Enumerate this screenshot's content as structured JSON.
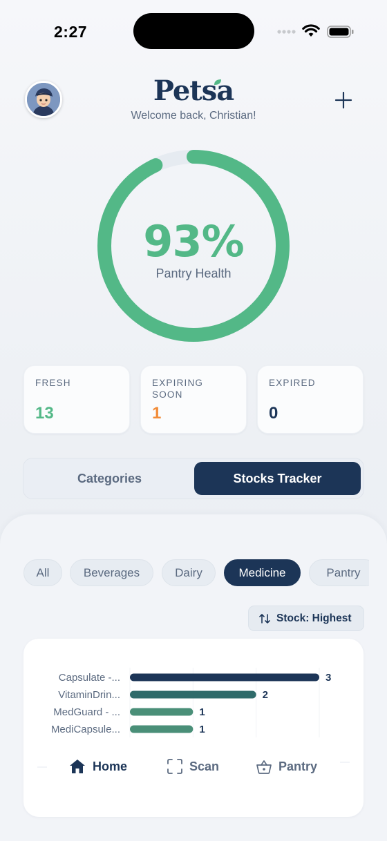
{
  "status_bar": {
    "time": "2:27"
  },
  "header": {
    "brand": "Petsa",
    "welcome": "Welcome back, Christian!"
  },
  "health": {
    "percent_label": "93%",
    "percent_value": 93,
    "label": "Pantry Health",
    "color": "#53b887",
    "track_color": "#e6ebf1"
  },
  "stats": [
    {
      "title": "FRESH",
      "value": "13",
      "color": "#53b887"
    },
    {
      "title": "EXPIRING SOON",
      "value": "1",
      "color": "#f28c38"
    },
    {
      "title": "EXPIRED",
      "value": "0",
      "color": "#1c3557"
    }
  ],
  "tabs": {
    "categories": "Categories",
    "stocks": "Stocks Tracker",
    "active": "stocks"
  },
  "filters": {
    "chips": [
      "All",
      "Beverages",
      "Dairy",
      "Medicine",
      "Pantry"
    ],
    "active": "Medicine"
  },
  "sort": {
    "label": "Stock: Highest"
  },
  "chart_data": {
    "type": "bar",
    "orientation": "horizontal",
    "categories": [
      "Capsulate -...",
      "VitaminDrin...",
      "MedGuard - ...",
      "MediCapsule..."
    ],
    "values": [
      3,
      2,
      1,
      1
    ],
    "xlim": [
      0,
      3
    ],
    "grid": true,
    "colors": [
      "#1c3557",
      "#2f6b6a",
      "#4a8f78",
      "#4a8f78"
    ]
  },
  "nav": {
    "home": "Home",
    "scan": "Scan",
    "pantry": "Pantry",
    "active": "home"
  }
}
